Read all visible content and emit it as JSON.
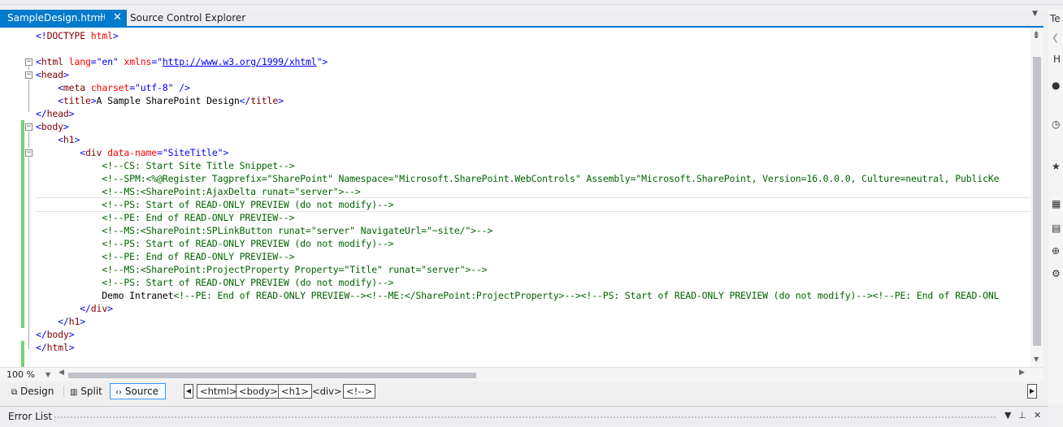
{
  "tabs": {
    "active_title": "SampleDesign.html",
    "pin_glyph": "⊣",
    "close_glyph": "✕",
    "inactive_title": "Source Control Explorer",
    "dropdown_glyph": "▼"
  },
  "right_panel": {
    "label_top": "Te",
    "label_h": "H"
  },
  "code_lines": [
    "<!DOCTYPE html>",
    "",
    "<html lang=\"en\" xmlns=\"http://www.w3.org/1999/xhtml\">",
    "<head>",
    "    <meta charset=\"utf-8\" />",
    "    <title>A Sample SharePoint Design</title>",
    "</head>",
    "<body>",
    "    <h1>",
    "        <div data-name=\"SiteTitle\">",
    "            <!--CS: Start Site Title Snippet-->",
    "            <!--SPM:<%@Register Tagprefix=\"SharePoint\" Namespace=\"Microsoft.SharePoint.WebControls\" Assembly=\"Microsoft.SharePoint, Version=16.0.0.0, Culture=neutral, PublicKe",
    "            <!--MS:<SharePoint:AjaxDelta runat=\"server\">-->",
    "            <!--PS: Start of READ-ONLY PREVIEW (do not modify)-->",
    "            <!--PE: End of READ-ONLY PREVIEW-->",
    "            <!--MS:<SharePoint:SPLinkButton runat=\"server\" NavigateUrl=\"~site/\">-->",
    "            <!--PS: Start of READ-ONLY PREVIEW (do not modify)-->",
    "            <!--PE: End of READ-ONLY PREVIEW-->",
    "            <!--MS:<SharePoint:ProjectProperty Property=\"Title\" runat=\"server\">-->",
    "            <!--PS: Start of READ-ONLY PREVIEW (do not modify)-->",
    "            Demo Intranet<!--PE: End of READ-ONLY PREVIEW--><!--ME:</SharePoint:ProjectProperty>--><!--PS: Start of READ-ONLY PREVIEW (do not modify)--><!--PE: End of READ-ONL",
    "        </div>",
    "    </h1>",
    "</body>",
    "</html>"
  ],
  "status": {
    "zoom": "100 %"
  },
  "view_bar": {
    "design_label": "Design",
    "split_label": "Split",
    "source_label": "Source",
    "breadcrumbs": [
      "<html>",
      "<body>",
      "<h1>",
      "<div>",
      "<!-->"
    ],
    "selected_crumb": "<div>"
  },
  "error_list": {
    "title": "Error List"
  },
  "colors": {
    "accent": "#007acc",
    "tag": "#800000",
    "attribute": "#ff0000",
    "value": "#0000ff",
    "comment": "#006400",
    "change_bar": "#6fd66f"
  }
}
